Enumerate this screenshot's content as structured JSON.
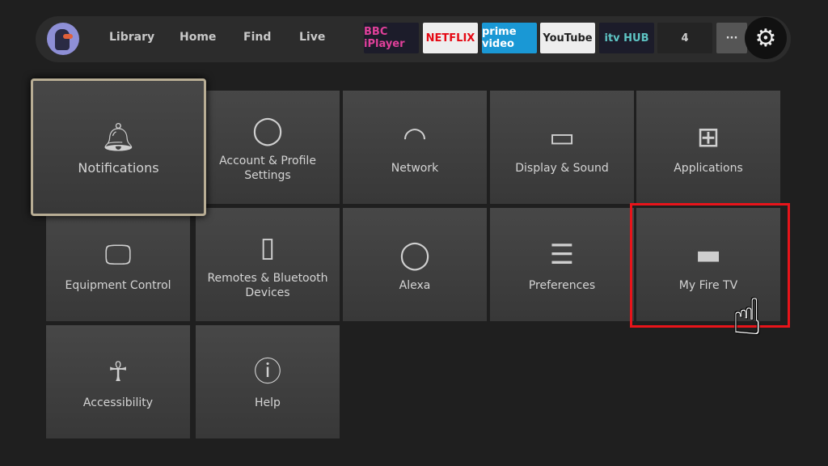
{
  "nav": {
    "links": [
      "Library",
      "Home",
      "Find",
      "Live"
    ],
    "apps": [
      {
        "name": "BBC iPlayer",
        "bg": "#1c1c2a",
        "fg": "#e0409a"
      },
      {
        "name": "NETFLIX",
        "bg": "#eeeeee",
        "fg": "#e50914"
      },
      {
        "name": "prime video",
        "bg": "#1a98d5",
        "fg": "#ffffff"
      },
      {
        "name": "YouTube",
        "bg": "#eeeeee",
        "fg": "#222222"
      },
      {
        "name": "itv HUB",
        "bg": "#1c1c2a",
        "fg": "#5ec4c4"
      },
      {
        "name": "4",
        "bg": "#242424",
        "fg": "#cccccc"
      },
      {
        "name": "···",
        "bg": "#555555",
        "fg": "#dddddd"
      }
    ]
  },
  "tiles": [
    {
      "label": "Notifications",
      "icon": "bell-icon"
    },
    {
      "label": "Account & Profile Settings",
      "icon": "user-icon"
    },
    {
      "label": "Network",
      "icon": "wifi-icon"
    },
    {
      "label": "Display & Sound",
      "icon": "display-icon"
    },
    {
      "label": "Applications",
      "icon": "apps-icon"
    },
    {
      "label": "Equipment Control",
      "icon": "equipment-icon"
    },
    {
      "label": "Remotes & Bluetooth Devices",
      "icon": "remote-icon"
    },
    {
      "label": "Alexa",
      "icon": "alexa-icon"
    },
    {
      "label": "Preferences",
      "icon": "sliders-icon"
    },
    {
      "label": "My Fire TV",
      "icon": "firetv-icon"
    },
    {
      "label": "Accessibility",
      "icon": "accessibility-icon"
    },
    {
      "label": "Help",
      "icon": "help-icon"
    }
  ],
  "highlight_color": "#e8141a"
}
